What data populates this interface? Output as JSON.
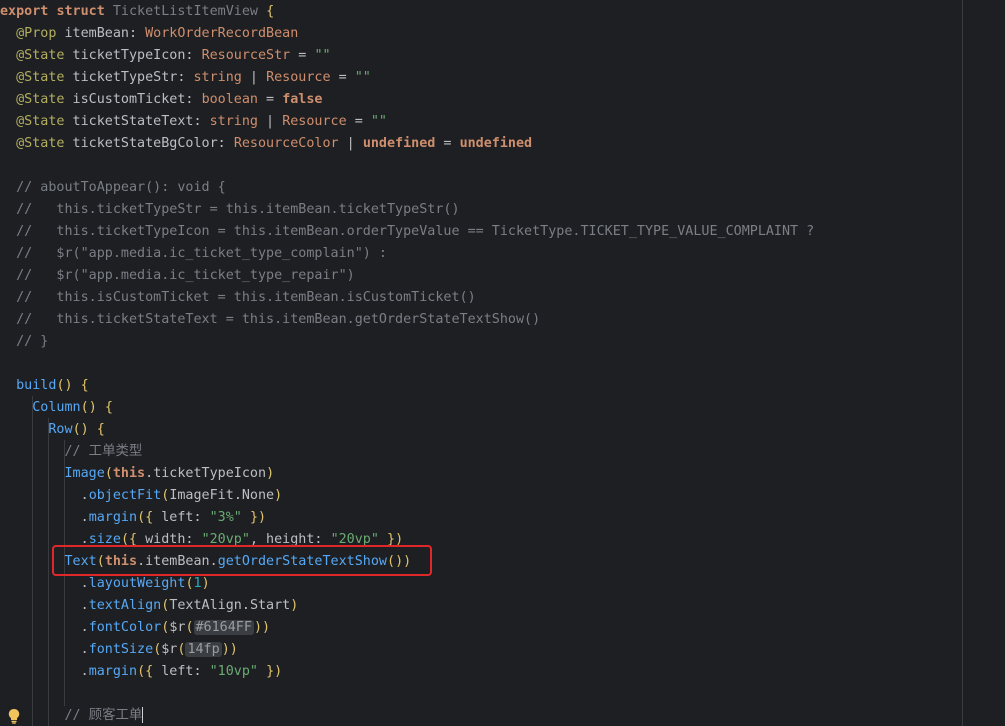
{
  "lines": [
    "export struct TicketListItemView {",
    "  @Prop itemBean: WorkOrderRecordBean",
    "  @State ticketTypeIcon: ResourceStr = \"\"",
    "  @State ticketTypeStr: string | Resource = \"\"",
    "  @State isCustomTicket: boolean = false",
    "  @State ticketStateText: string | Resource = \"\"",
    "  @State ticketStateBgColor: ResourceColor | undefined = undefined",
    "",
    "  // aboutToAppear(): void {",
    "  //   this.ticketTypeStr = this.itemBean.ticketTypeStr()",
    "  //   this.ticketTypeIcon = this.itemBean.orderTypeValue == TicketType.TICKET_TYPE_VALUE_COMPLAINT ?",
    "  //   $r(\"app.media.ic_ticket_type_complain\") :",
    "  //   $r(\"app.media.ic_ticket_type_repair\")",
    "  //   this.isCustomTicket = this.itemBean.isCustomTicket()",
    "  //   this.ticketStateText = this.itemBean.getOrderStateTextShow()",
    "  // }",
    "",
    "  build() {",
    "    Column() {",
    "      Row() {",
    "        // 工单类型",
    "        Image(this.ticketTypeIcon)",
    "          .objectFit(ImageFit.None)",
    "          .margin({ left: \"3%\" })",
    "          .size({ width: \"20vp\", height: \"20vp\" })",
    "        Text(this.itemBean.getOrderStateTextShow())",
    "          .layoutWeight(1)",
    "          .textAlign(TextAlign.Start)",
    "          .fontColor($r(#6164FF))",
    "          .fontSize($r(14fp))",
    "          .margin({ left: \"10vp\" })",
    "",
    "        // 顾客工单"
  ],
  "colors": {
    "background": "#1e1f22",
    "highlight_box": "#e0282b",
    "keyword": "#cf8e6d",
    "string": "#6aab73",
    "comment": "#7a7e85",
    "function": "#56a8f5",
    "annotation": "#b3ae60",
    "number": "#2aacb8"
  },
  "icons": {
    "gutter": "lightbulb-icon"
  }
}
